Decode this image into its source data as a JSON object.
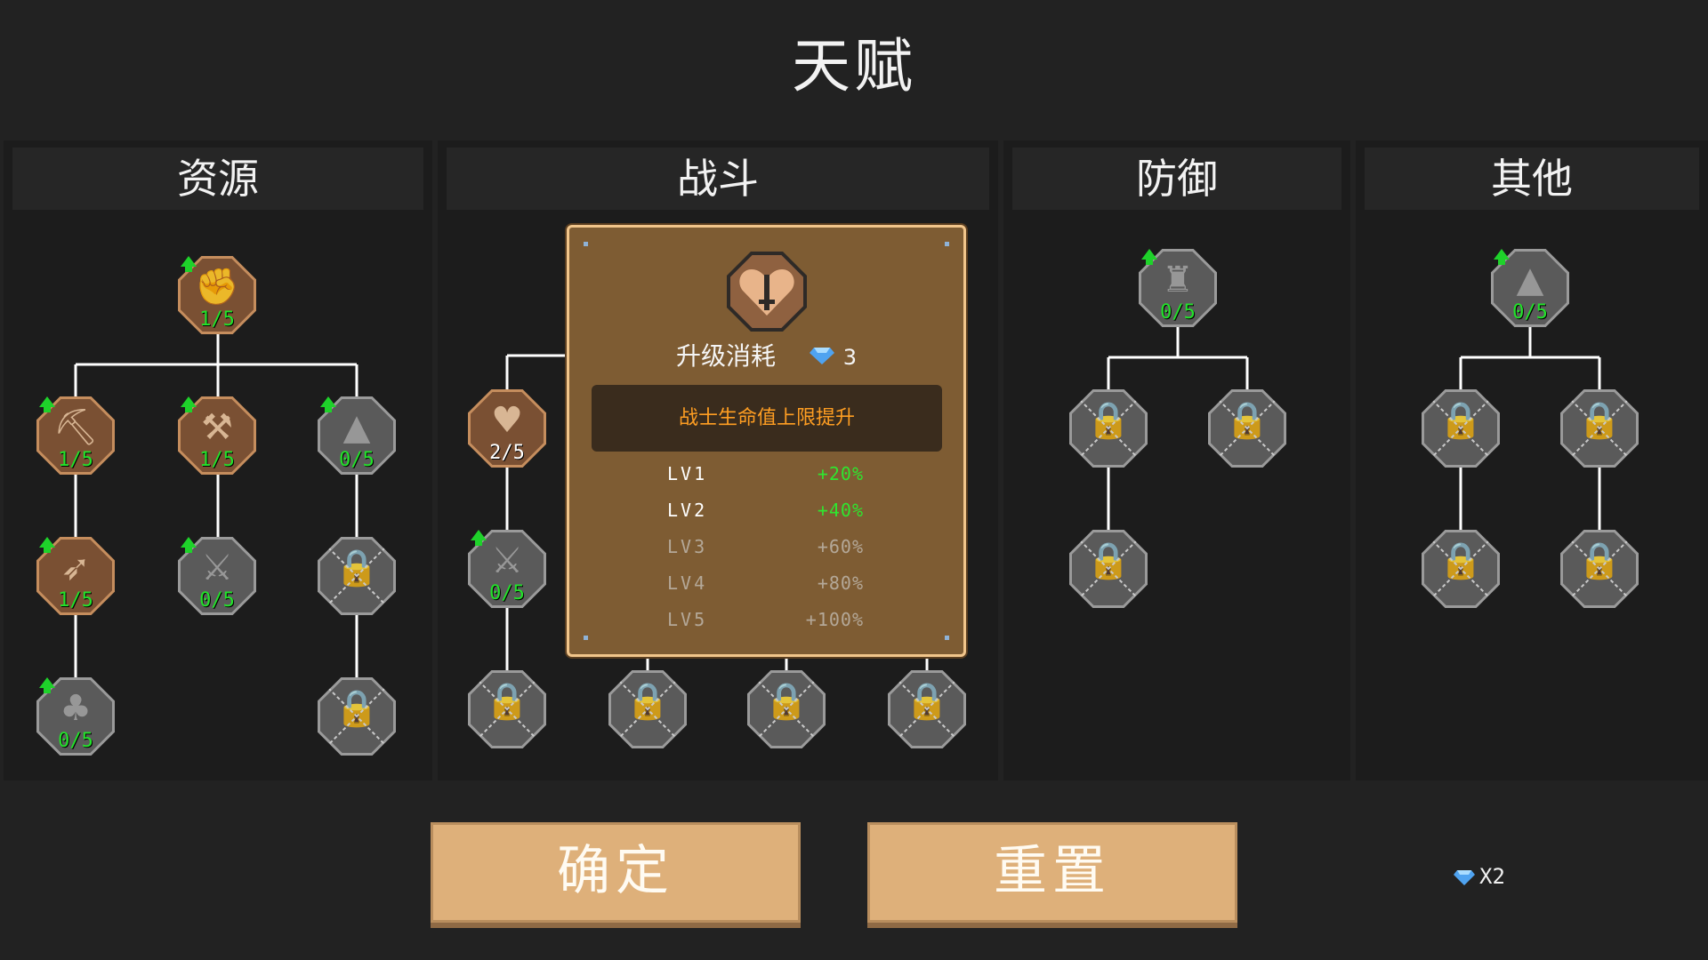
{
  "title": "天赋",
  "panels": [
    {
      "label": "资源"
    },
    {
      "label": "战斗"
    },
    {
      "label": "防御"
    },
    {
      "label": "其他"
    }
  ],
  "nodes": {
    "res_root": {
      "level": "1/5",
      "icon": "fist-icon",
      "state": "unlocked"
    },
    "res_a1": {
      "level": "1/5",
      "icon": "pickaxe-icon",
      "state": "unlocked"
    },
    "res_b1": {
      "level": "1/5",
      "icon": "pickaxe-icon",
      "state": "unlocked"
    },
    "res_c1": {
      "level": "0/5",
      "icon": "ore-pile-icon",
      "state": "available"
    },
    "res_a2": {
      "level": "1/5",
      "icon": "crossbow-icon",
      "state": "unlocked"
    },
    "res_b2": {
      "level": "0/5",
      "icon": "crossed-tools-icon",
      "state": "available"
    },
    "res_c2": {
      "level": "",
      "icon": "sword-lock-icon",
      "state": "locked"
    },
    "res_a3": {
      "level": "0/5",
      "icon": "tree-icon",
      "state": "available"
    },
    "res_c3": {
      "level": "",
      "icon": "horn-lock-icon",
      "state": "locked"
    },
    "cmb_heart": {
      "level": "2/5",
      "icon": "heart-sword-icon",
      "state": "selected"
    },
    "cmb_swords": {
      "level": "0/5",
      "icon": "crossed-swords-icon",
      "state": "available"
    },
    "cmb_l1": {
      "level": "",
      "icon": "fire-lock-icon",
      "state": "locked"
    },
    "cmb_l2": {
      "level": "",
      "icon": "tower-lock-icon",
      "state": "locked"
    },
    "cmb_l3": {
      "level": "",
      "icon": "vortex-lock-icon",
      "state": "locked"
    },
    "cmb_l4": {
      "level": "",
      "icon": "fountain-lock-icon",
      "state": "locked"
    },
    "def_root": {
      "level": "0/5",
      "icon": "castle-tower-icon",
      "state": "available"
    },
    "def_l1": {
      "level": "",
      "icon": "gear-lock-icon",
      "state": "locked"
    },
    "def_l2": {
      "level": "",
      "icon": "arrows-lock-icon",
      "state": "locked"
    },
    "def_l3": {
      "level": "",
      "icon": "beast-lock-icon",
      "state": "locked"
    },
    "oth_root": {
      "level": "0/5",
      "icon": "ore-pile-icon",
      "state": "available"
    },
    "oth_l1": {
      "level": "",
      "icon": "chest-lock-icon",
      "state": "locked"
    },
    "oth_l2": {
      "level": "",
      "icon": "cross-lock-icon",
      "state": "locked"
    },
    "oth_l3": {
      "level": "",
      "icon": "hourglass-lock-icon",
      "state": "locked"
    },
    "oth_l4": {
      "level": "",
      "icon": "plus-lock-icon",
      "state": "locked"
    }
  },
  "popup": {
    "cost_label": "升级消耗",
    "cost_value": "3",
    "description": "战士生命值上限提升",
    "levels": [
      {
        "lv": "LV1",
        "value": "+20%",
        "active": true
      },
      {
        "lv": "LV2",
        "value": "+40%",
        "active": true
      },
      {
        "lv": "LV3",
        "value": "+60%",
        "active": false
      },
      {
        "lv": "LV4",
        "value": "+80%",
        "active": false
      },
      {
        "lv": "LV5",
        "value": "+100%",
        "active": false
      }
    ]
  },
  "buttons": {
    "confirm": "确定",
    "reset": "重置"
  },
  "currency": {
    "count": "X2",
    "icon": "gem-icon"
  },
  "colors": {
    "unlocked_border": "#c58d5d",
    "level_text": "#22e32a",
    "desc_text": "#ff9e22",
    "button": "#deb07a",
    "gem": "#4fa3f0"
  }
}
